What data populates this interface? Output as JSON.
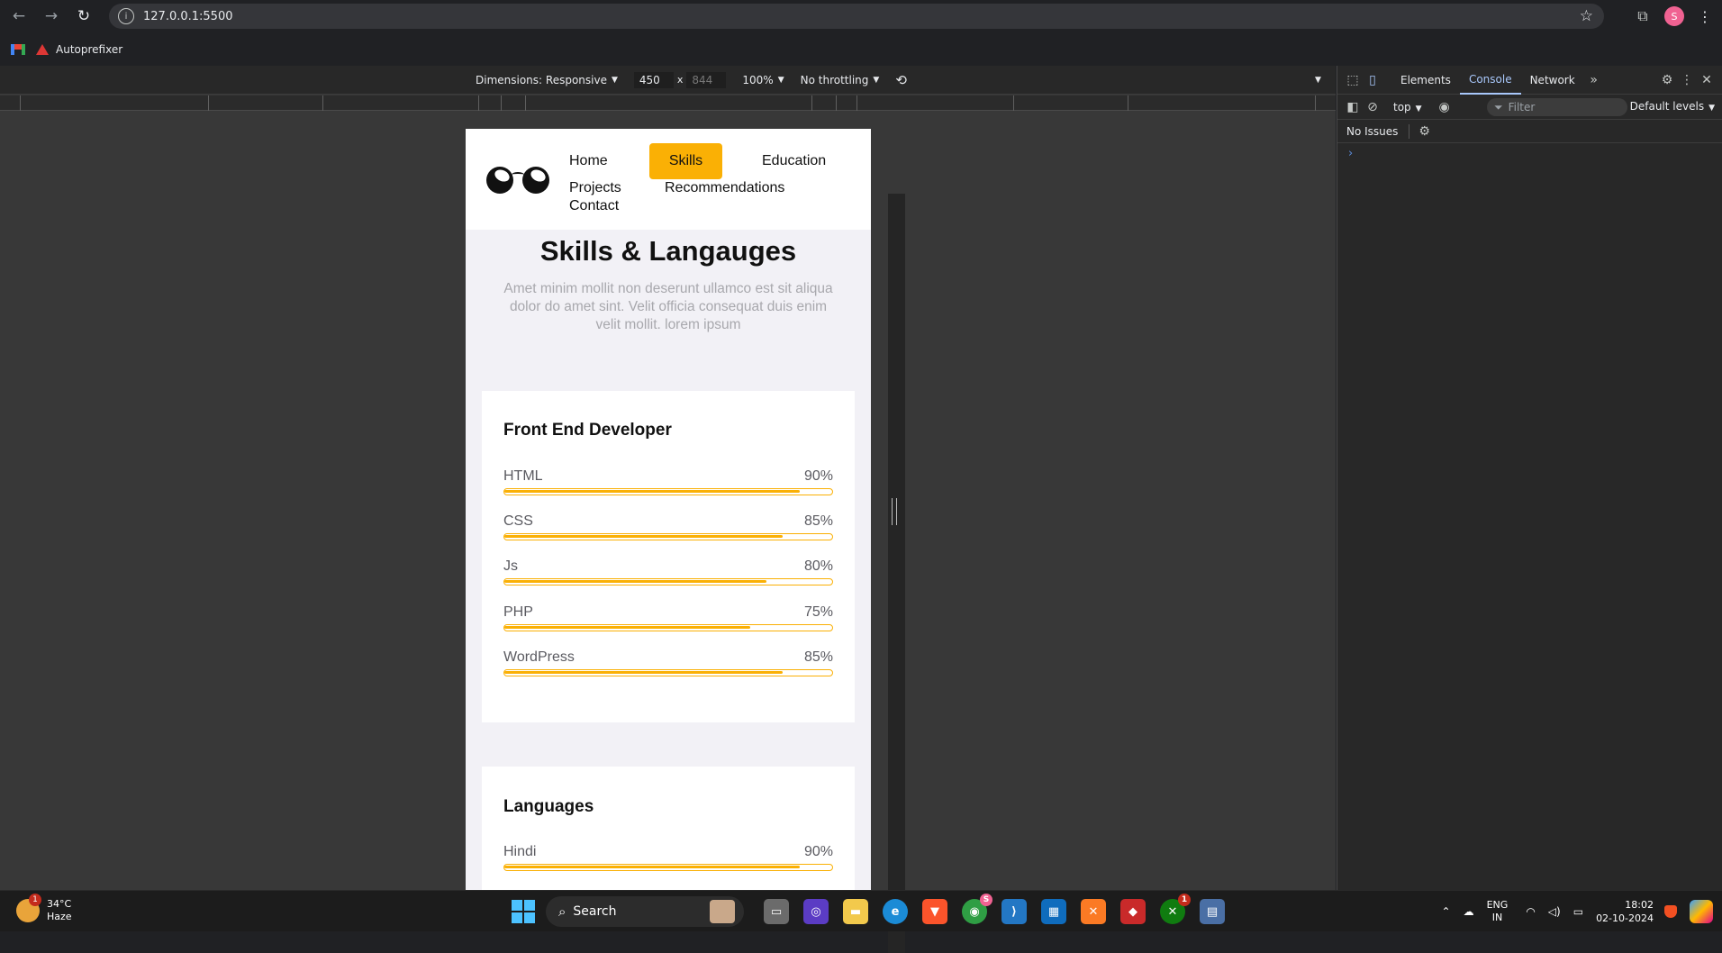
{
  "browser": {
    "url": "127.0.0.1:5500",
    "bookmarks": [
      "Autoprefixer"
    ],
    "profile_initial": "S"
  },
  "device_toolbar": {
    "dimensions_label": "Dimensions: Responsive",
    "width": "450",
    "times": "x",
    "height": "844",
    "zoom": "100%",
    "throttling": "No throttling"
  },
  "page": {
    "nav": {
      "home": "Home",
      "skills": "Skills",
      "education": "Education",
      "projects": "Projects",
      "recommendations": "Recommendations",
      "contact": "Contact"
    },
    "section_title": "Skills & Langauges",
    "section_subtitle": "Amet minim mollit non deserunt ullamco est sit aliqua dolor do amet sint. Velit officia consequat duis enim velit mollit. lorem ipsum",
    "cards": [
      {
        "title": "Front End Developer",
        "skills": [
          {
            "name": "HTML",
            "label": "90%",
            "value": 90
          },
          {
            "name": "CSS",
            "label": "85%",
            "value": 85
          },
          {
            "name": "Js",
            "label": "80%",
            "value": 80
          },
          {
            "name": "PHP",
            "label": "75%",
            "value": 75
          },
          {
            "name": "WordPress",
            "label": "85%",
            "value": 85
          }
        ]
      },
      {
        "title": "Languages",
        "skills": [
          {
            "name": "Hindi",
            "label": "90%",
            "value": 90
          }
        ]
      }
    ],
    "accent_color": "#fab005"
  },
  "devtools": {
    "tabs": [
      "Elements",
      "Console",
      "Network"
    ],
    "active_tab": "Console",
    "context": "top",
    "filter_placeholder": "Filter",
    "levels": "Default levels",
    "issues": "No Issues",
    "prompt": "›"
  },
  "taskbar": {
    "weather_temp": "34°C",
    "weather_desc": "Haze",
    "weather_badge": "1",
    "search_label": "Search",
    "chrome_badge": "S",
    "xbox_badge": "1",
    "lang_line1": "ENG",
    "lang_line2": "IN",
    "time": "18:02",
    "date": "02-10-2024"
  }
}
